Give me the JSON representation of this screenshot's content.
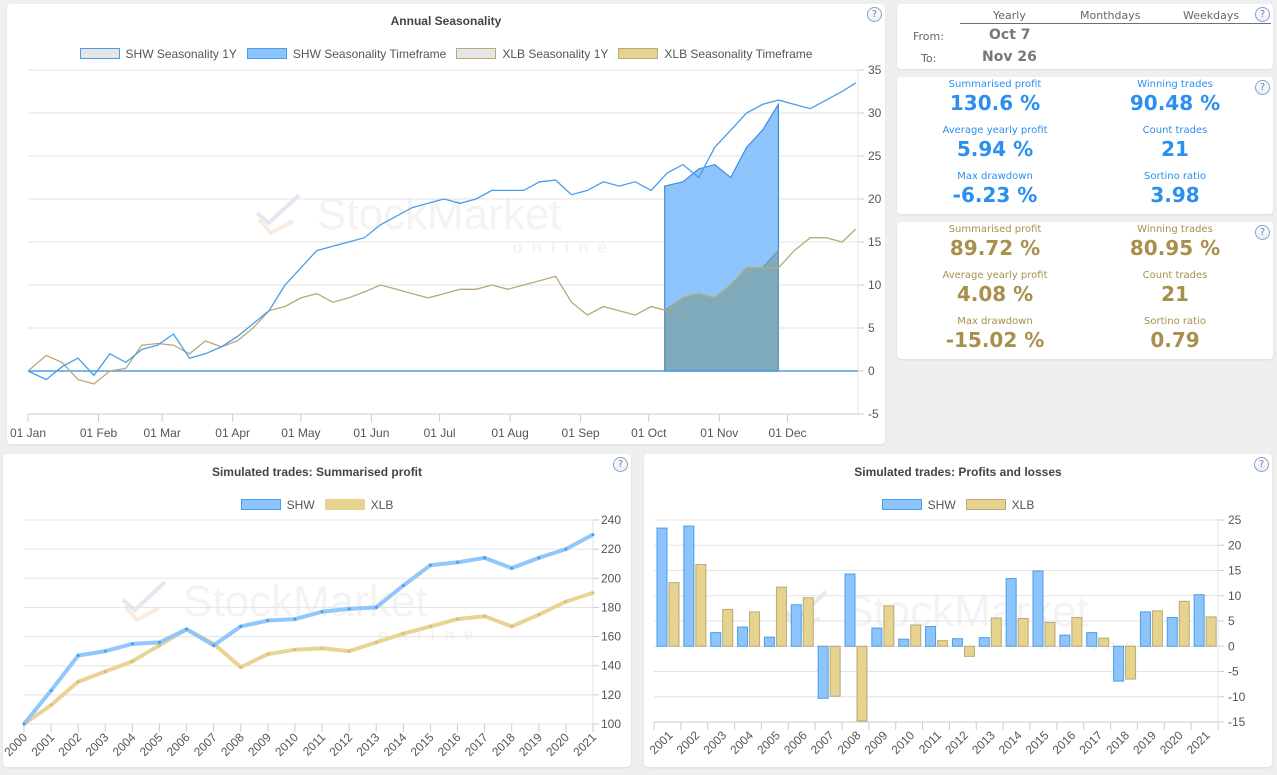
{
  "annual": {
    "title": "Annual Seasonality",
    "legend": [
      {
        "label": "SHW Seasonality 1Y",
        "fill": "#e6e6e6",
        "stroke": "#4a9de8"
      },
      {
        "label": "SHW Seasonality Timeframe",
        "fill": "#8cc4fb",
        "stroke": "#4a9de8"
      },
      {
        "label": "XLB Seasonality 1Y",
        "fill": "#e6e6e6",
        "stroke": "#b8a978"
      },
      {
        "label": "XLB Seasonality Timeframe",
        "fill": "#e6d38f",
        "stroke": "#b8a978"
      }
    ]
  },
  "selector": {
    "tabs": [
      "Yearly",
      "Monthdays",
      "Weekdays"
    ],
    "from_label": "From:",
    "from_value": "Oct 7",
    "to_label": "To:",
    "to_value": "Nov 26"
  },
  "shw_stats": {
    "color": "#2b8ff0",
    "items": [
      {
        "label": "Summarised profit",
        "value": "130.6 %"
      },
      {
        "label": "Winning trades",
        "value": "90.48 %"
      },
      {
        "label": "Average yearly profit",
        "value": "5.94 %"
      },
      {
        "label": "Count trades",
        "value": "21"
      },
      {
        "label": "Max drawdown",
        "value": "-6.23 %"
      },
      {
        "label": "Sortino ratio",
        "value": "3.98"
      }
    ]
  },
  "xlb_stats": {
    "color": "#a8904c",
    "items": [
      {
        "label": "Summarised profit",
        "value": "89.72 %"
      },
      {
        "label": "Winning trades",
        "value": "80.95 %"
      },
      {
        "label": "Average yearly profit",
        "value": "4.08 %"
      },
      {
        "label": "Count trades",
        "value": "21"
      },
      {
        "label": "Max drawdown",
        "value": "-15.02 %"
      },
      {
        "label": "Sortino ratio",
        "value": "0.79"
      }
    ]
  },
  "summarised": {
    "title": "Simulated trades: Summarised profit",
    "legend": [
      {
        "label": "SHW",
        "fill": "#8cc4fb",
        "stroke": "#4a9de8"
      },
      {
        "label": "XLB",
        "fill": "#e6d38f",
        "stroke": "#e6d38f"
      }
    ]
  },
  "pnl": {
    "title": "Simulated trades: Profits and losses",
    "legend": [
      {
        "label": "SHW",
        "fill": "#8cc4fb",
        "stroke": "#4a9de8"
      },
      {
        "label": "XLB",
        "fill": "#e6d38f",
        "stroke": "#b8a978"
      }
    ]
  },
  "help_glyph": "?",
  "watermark": {
    "main": "StockMarket",
    "sub": "online"
  },
  "chart_data": [
    {
      "type": "line",
      "title": "Annual Seasonality",
      "xlabel": "",
      "ylabel": "",
      "x_ticks": [
        "01 Jan",
        "01 Feb",
        "01 Mar",
        "01 Apr",
        "01 May",
        "01 Jun",
        "01 Jul",
        "01 Aug",
        "01 Sep",
        "01 Oct",
        "01 Nov",
        "01 Dec"
      ],
      "ylim": [
        -5,
        35
      ],
      "y_ticks": [
        -5,
        0,
        5,
        10,
        15,
        20,
        25,
        30,
        35
      ],
      "grid": true,
      "legend_position": "top",
      "timeframe": {
        "from_day": 280,
        "to_day": 330
      },
      "series": [
        {
          "name": "SHW Seasonality 1Y",
          "color": "#4a9de8",
          "day": [
            0,
            8,
            15,
            22,
            29,
            36,
            43,
            50,
            57,
            64,
            71,
            78,
            85,
            92,
            99,
            106,
            113,
            120,
            127,
            134,
            141,
            148,
            155,
            162,
            169,
            176,
            183,
            190,
            197,
            204,
            211,
            218,
            225,
            232,
            239,
            246,
            253,
            260,
            267,
            274,
            281,
            288,
            295,
            302,
            309,
            316,
            323,
            330,
            337,
            344,
            351,
            358,
            364
          ],
          "values": [
            0,
            -1,
            0.5,
            1.5,
            -0.5,
            2,
            1,
            2.5,
            3,
            4.3,
            1.5,
            2,
            2.8,
            4,
            5.5,
            7,
            10,
            12,
            14,
            14.5,
            15,
            15.5,
            17,
            18,
            19,
            19.5,
            20,
            19.5,
            20,
            21,
            21,
            21,
            22,
            22.2,
            20.5,
            21,
            22,
            21.5,
            22,
            21,
            23,
            24,
            22.5,
            26,
            28,
            30,
            31,
            31.5,
            31,
            30.5,
            31.5,
            32.5,
            33.5
          ]
        },
        {
          "name": "SHW Seasonality Timeframe",
          "color": "#4a9de8",
          "day": [
            280,
            288,
            295,
            302,
            309,
            316,
            323,
            330
          ],
          "values": [
            21.5,
            22,
            23.5,
            24,
            22.5,
            26,
            28,
            31
          ]
        },
        {
          "name": "XLB Seasonality 1Y",
          "color": "#b8a978",
          "day": [
            0,
            8,
            15,
            22,
            29,
            36,
            43,
            50,
            57,
            64,
            71,
            78,
            85,
            92,
            99,
            106,
            113,
            120,
            127,
            134,
            141,
            148,
            155,
            162,
            169,
            176,
            183,
            190,
            197,
            204,
            211,
            218,
            225,
            232,
            239,
            246,
            253,
            260,
            267,
            274,
            281,
            288,
            295,
            302,
            309,
            316,
            323,
            330,
            337,
            344,
            351,
            358,
            364
          ],
          "values": [
            0,
            1.8,
            1,
            -1,
            -1.5,
            0,
            0.3,
            3,
            3.2,
            3,
            2,
            3.5,
            2.8,
            3.5,
            5,
            7,
            7.5,
            8.5,
            9,
            8,
            8.5,
            9.2,
            10,
            9.5,
            9,
            8.5,
            9,
            9.5,
            9.5,
            10,
            9.5,
            10,
            10.5,
            11,
            8,
            6.5,
            7.5,
            7,
            6.5,
            7.5,
            7,
            8.5,
            9,
            8.5,
            10,
            12,
            12,
            12,
            14,
            15.5,
            15.5,
            15,
            16.5
          ]
        },
        {
          "name": "XLB Seasonality Timeframe",
          "color": "#b8a978",
          "day": [
            280,
            288,
            295,
            302,
            309,
            316,
            323,
            330
          ],
          "values": [
            7,
            8.5,
            9,
            8.5,
            10,
            12,
            12,
            14
          ]
        }
      ]
    },
    {
      "type": "line",
      "title": "Simulated trades: Summarised profit",
      "categories": [
        "2000",
        "2001",
        "2002",
        "2003",
        "2004",
        "2005",
        "2006",
        "2007",
        "2008",
        "2009",
        "2010",
        "2011",
        "2012",
        "2013",
        "2014",
        "2015",
        "2016",
        "2017",
        "2018",
        "2019",
        "2020",
        "2021"
      ],
      "ylim": [
        100,
        240
      ],
      "y_ticks": [
        100,
        120,
        140,
        160,
        180,
        200,
        220,
        240
      ],
      "grid": true,
      "legend_position": "top",
      "series": [
        {
          "name": "SHW",
          "color": "#8cc4fb",
          "values": [
            100,
            123,
            147,
            150,
            155,
            156,
            165,
            154,
            167,
            171,
            172,
            177,
            179,
            180,
            195,
            209,
            211,
            214,
            207,
            214,
            220,
            230
          ]
        },
        {
          "name": "XLB",
          "color": "#e6d38f",
          "values": [
            100,
            113,
            129,
            136,
            143,
            154,
            165,
            155,
            139,
            148,
            151,
            152,
            150,
            156,
            162,
            167,
            172,
            174,
            167,
            175,
            184,
            190
          ]
        }
      ]
    },
    {
      "type": "bar",
      "title": "Simulated trades: Profits and losses",
      "categories": [
        "2001",
        "2002",
        "2003",
        "2004",
        "2005",
        "2006",
        "2007",
        "2008",
        "2009",
        "2010",
        "2011",
        "2012",
        "2013",
        "2014",
        "2015",
        "2016",
        "2017",
        "2018",
        "2019",
        "2020",
        "2021"
      ],
      "ylim": [
        -15,
        25
      ],
      "y_ticks": [
        -15,
        -10,
        -5,
        0,
        5,
        10,
        15,
        20,
        25
      ],
      "grid": true,
      "legend_position": "top",
      "series": [
        {
          "name": "SHW",
          "color": "#8cc4fb",
          "values": [
            23.4,
            23.8,
            2.7,
            3.8,
            1.8,
            8.2,
            -10.3,
            14.3,
            3.6,
            1.4,
            3.9,
            1.5,
            1.7,
            13.4,
            14.9,
            2.2,
            2.7,
            -6.9,
            6.8,
            5.7,
            10.2
          ]
        },
        {
          "name": "XLB",
          "color": "#e6d38f",
          "values": [
            12.6,
            16.2,
            7.3,
            6.8,
            11.7,
            9.6,
            -9.9,
            -14.8,
            8.0,
            4.2,
            1.1,
            -2.0,
            5.6,
            5.5,
            4.7,
            5.7,
            1.6,
            -6.5,
            7.0,
            8.9,
            5.8
          ]
        }
      ]
    }
  ]
}
